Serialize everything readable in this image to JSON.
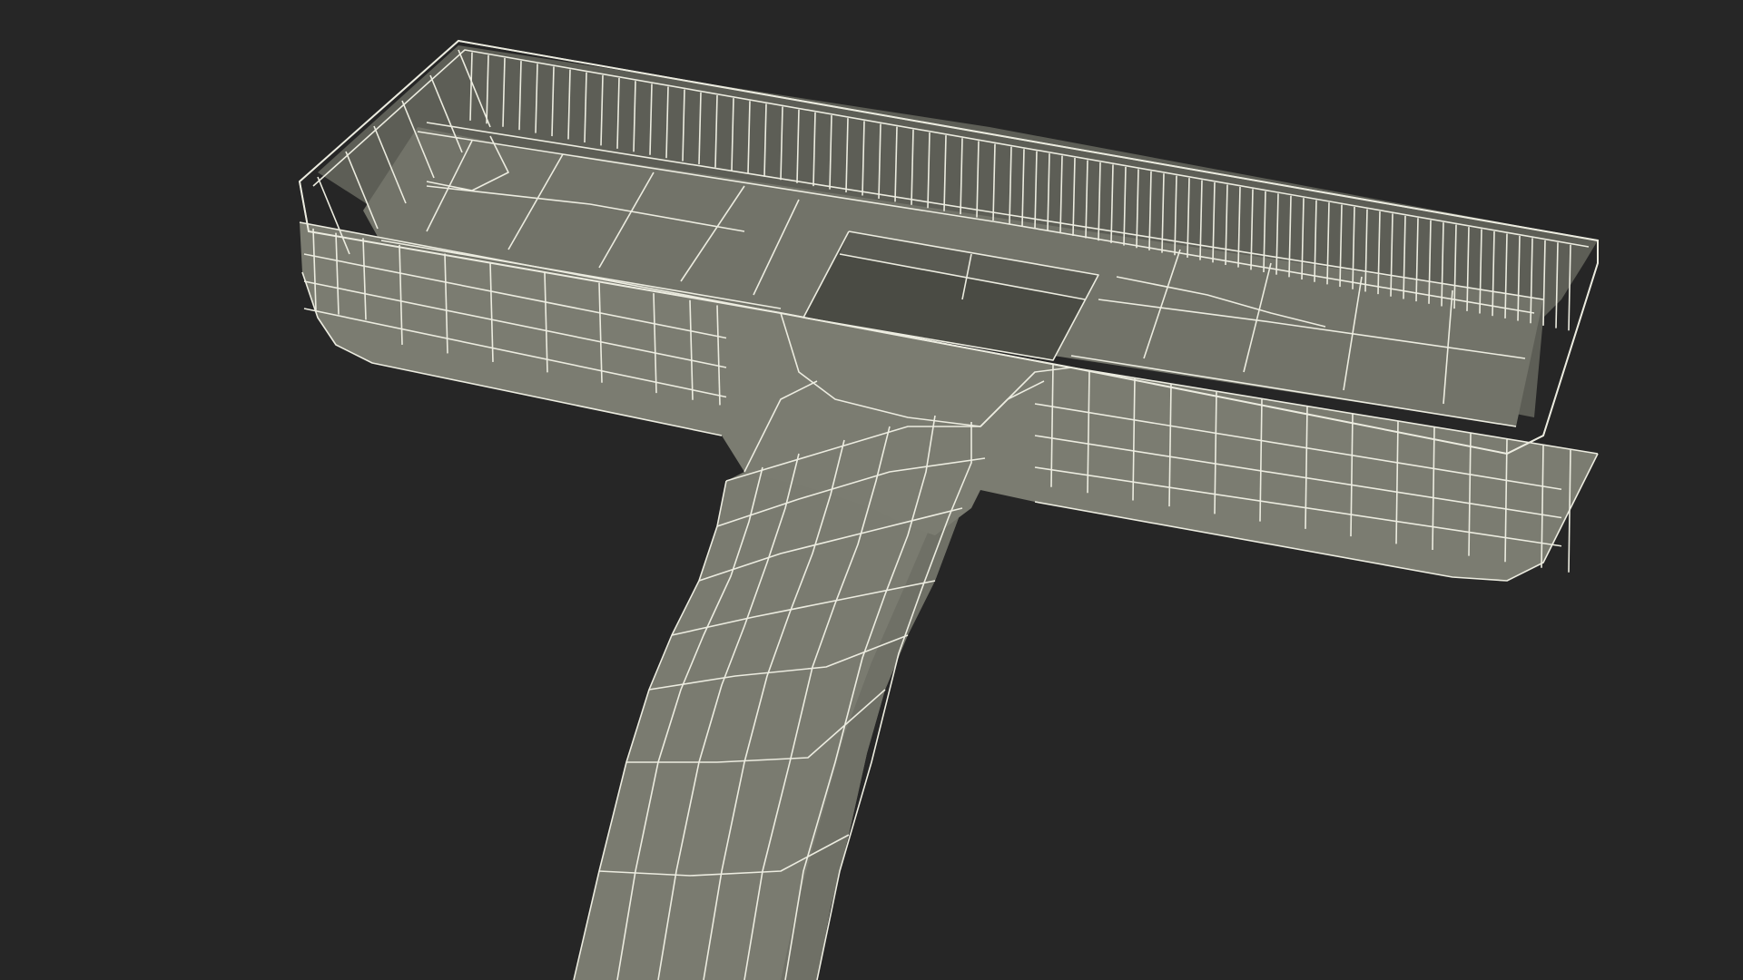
{
  "scene": {
    "background_color": "#262626",
    "object": "vacuum-floor-nozzle-wireframe",
    "colors": {
      "surface_top": "#76776c",
      "surface_front": "#7b7c71",
      "surface_inner": "#6c6d63",
      "surface_dark_opening": "#4a4b44",
      "surface_wall_inner": "#5d5e56",
      "neck_surface": "#7a7b70",
      "wire": "#ecece0"
    }
  }
}
